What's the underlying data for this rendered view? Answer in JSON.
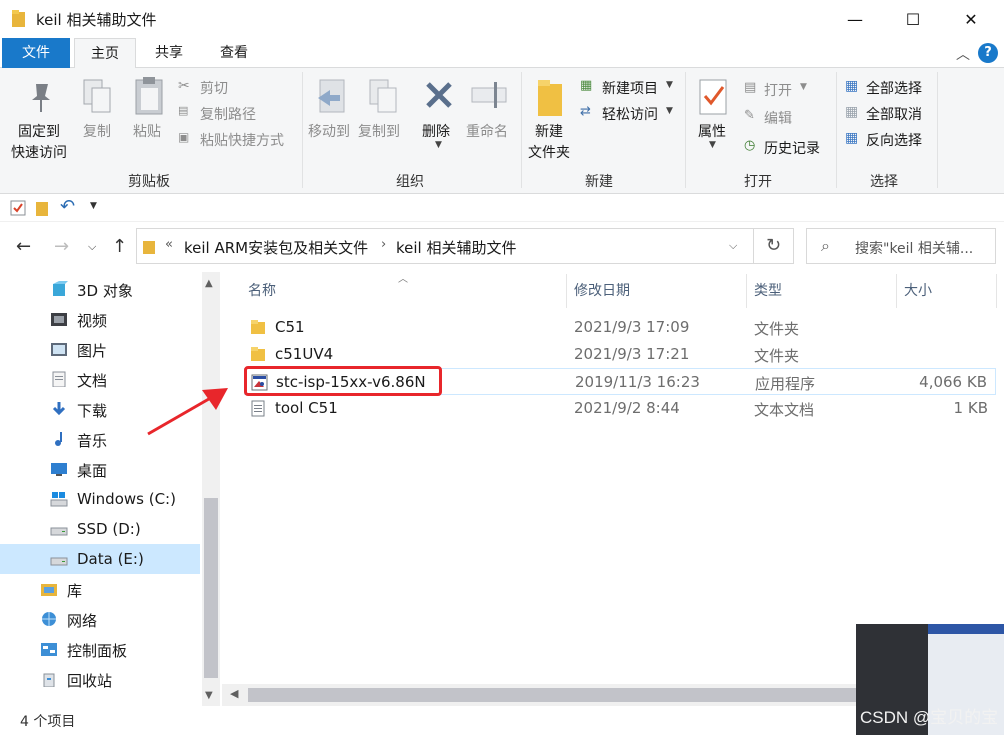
{
  "window": {
    "title": "keil 相关辅助文件",
    "minimize_glyph": "—",
    "maximize_glyph": "☐",
    "close_glyph": "✕"
  },
  "ribbon_tabs": [
    "文件",
    "主页",
    "共享",
    "查看"
  ],
  "ribbon": {
    "clipboard": {
      "pin_line1": "固定到",
      "pin_line2": "快速访问",
      "copy": "复制",
      "paste": "粘贴",
      "cut": "剪切",
      "copy_path": "复制路径",
      "paste_shortcut": "粘贴快捷方式",
      "group": "剪贴板"
    },
    "organize": {
      "move_to": "移动到",
      "copy_to": "复制到",
      "delete": "删除",
      "rename": "重命名",
      "group": "组织"
    },
    "new": {
      "new_folder_line1": "新建",
      "new_folder_line2": "文件夹",
      "new_item": "新建项目",
      "easy_access": "轻松访问",
      "group": "新建"
    },
    "open": {
      "properties": "属性",
      "open": "打开",
      "edit": "编辑",
      "history": "历史记录",
      "group": "打开"
    },
    "select": {
      "select_all": "全部选择",
      "select_none": "全部取消",
      "invert": "反向选择",
      "group": "选择"
    }
  },
  "address": {
    "overflow": "«",
    "crumbs": [
      "keil ARM安装包及相关文件",
      "keil 相关辅助文件"
    ],
    "search_placeholder": "搜索\"keil 相关辅..."
  },
  "nav_items": [
    {
      "label": "3D 对象",
      "icon": "3d-objects-icon"
    },
    {
      "label": "视频",
      "icon": "video-icon"
    },
    {
      "label": "图片",
      "icon": "pictures-icon"
    },
    {
      "label": "文档",
      "icon": "documents-icon"
    },
    {
      "label": "下载",
      "icon": "downloads-icon"
    },
    {
      "label": "音乐",
      "icon": "music-icon"
    },
    {
      "label": "桌面",
      "icon": "desktop-icon"
    },
    {
      "label": "Windows (C:)",
      "icon": "windows-drive-icon"
    },
    {
      "label": "SSD (D:)",
      "icon": "drive-icon"
    },
    {
      "label": "Data (E:)",
      "icon": "drive-icon",
      "selected": true
    },
    {
      "label": "库",
      "icon": "libraries-icon"
    },
    {
      "label": "网络",
      "icon": "network-icon"
    },
    {
      "label": "控制面板",
      "icon": "control-panel-icon"
    },
    {
      "label": "回收站",
      "icon": "recycle-bin-icon"
    }
  ],
  "columns": [
    "名称",
    "修改日期",
    "类型",
    "大小"
  ],
  "files": [
    {
      "name": "C51",
      "date": "2021/9/3 17:09",
      "type": "文件夹",
      "size": "",
      "icon": "folder-icon"
    },
    {
      "name": "c51UV4",
      "date": "2021/9/3 17:21",
      "type": "文件夹",
      "size": "",
      "icon": "folder-icon"
    },
    {
      "name": "stc-isp-15xx-v6.86N",
      "date": "2019/11/3 16:23",
      "type": "应用程序",
      "size": "4,066 KB",
      "icon": "application-icon"
    },
    {
      "name": "tool C51",
      "date": "2021/9/2 8:44",
      "type": "文本文档",
      "size": "1 KB",
      "icon": "text-file-icon"
    }
  ],
  "status": {
    "item_count": "4 个项目"
  },
  "watermark": "CSDN @宝贝的宝",
  "colors": {
    "accent": "#1979ca",
    "selection": "#cce8ff",
    "annotation_red": "#e8262b"
  }
}
